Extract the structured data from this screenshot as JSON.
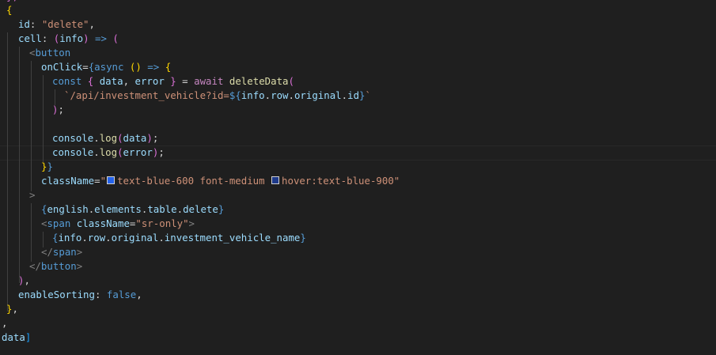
{
  "editor": {
    "lines": [
      [
        [
          "t-brace2",
          "},"
        ]
      ],
      [
        [
          "t-brace1",
          "{"
        ]
      ],
      [
        [
          "t-property",
          "id"
        ],
        [
          "t-punct",
          ": "
        ],
        [
          "t-string",
          "\"delete\""
        ],
        [
          "t-punct",
          ","
        ]
      ],
      [
        [
          "t-property",
          "cell"
        ],
        [
          "t-punct",
          ": "
        ],
        [
          "t-brace2",
          "("
        ],
        [
          "t-variable",
          "info"
        ],
        [
          "t-brace2",
          ")"
        ],
        [
          "t-keyword",
          " => "
        ],
        [
          "t-brace2",
          "("
        ]
      ],
      [
        [
          "t-tagbr",
          "<"
        ],
        [
          "t-tag",
          "button"
        ]
      ],
      [
        [
          "t-attr",
          "onClick"
        ],
        [
          "t-punct",
          "="
        ],
        [
          "t-keyword",
          "{async"
        ],
        [
          "t-punct",
          " "
        ],
        [
          "t-brace1",
          "()"
        ],
        [
          "t-keyword",
          " => "
        ],
        [
          "t-brace1",
          "{"
        ]
      ],
      [
        [
          "t-keyword",
          "const"
        ],
        [
          "t-punct",
          " "
        ],
        [
          "t-brace2",
          "{"
        ],
        [
          "t-variable",
          " data"
        ],
        [
          "t-punct",
          ", "
        ],
        [
          "t-variable",
          "error"
        ],
        [
          "t-brace2",
          " }"
        ],
        [
          "t-punct",
          " = "
        ],
        [
          "t-control",
          "await"
        ],
        [
          "t-punct",
          " "
        ],
        [
          "t-function",
          "deleteData"
        ],
        [
          "t-brace2",
          "("
        ]
      ],
      [
        [
          "t-string",
          "`/api/investment_vehicle?id="
        ],
        [
          "t-keyword",
          "${"
        ],
        [
          "t-variable",
          "info"
        ],
        [
          "t-punct",
          "."
        ],
        [
          "t-variable",
          "row"
        ],
        [
          "t-punct",
          "."
        ],
        [
          "t-variable",
          "original"
        ],
        [
          "t-punct",
          "."
        ],
        [
          "t-variable",
          "id"
        ],
        [
          "t-keyword",
          "}"
        ],
        [
          "t-string",
          "`"
        ]
      ],
      [
        [
          "t-brace2",
          ")"
        ],
        [
          "t-punct",
          ";"
        ]
      ],
      [],
      [
        [
          "t-variable",
          "console"
        ],
        [
          "t-punct",
          "."
        ],
        [
          "t-function",
          "log"
        ],
        [
          "t-brace2",
          "("
        ],
        [
          "t-variable",
          "data"
        ],
        [
          "t-brace2",
          ")"
        ],
        [
          "t-punct",
          ";"
        ]
      ],
      [
        [
          "t-variable",
          "console"
        ],
        [
          "t-punct",
          "."
        ],
        [
          "t-function",
          "log"
        ],
        [
          "t-brace2",
          "("
        ],
        [
          "t-variable",
          "error"
        ],
        [
          "t-brace2",
          ")"
        ],
        [
          "t-punct",
          ";"
        ]
      ],
      [
        [
          "t-brace1",
          "}"
        ],
        [
          "t-keyword",
          "}"
        ]
      ],
      [
        [
          "t-attr",
          "className"
        ],
        [
          "t-punct",
          "="
        ],
        [
          "t-string",
          "\""
        ],
        [
          "swatch",
          "#2563eb"
        ],
        [
          "t-string",
          "text-blue-600 font-medium "
        ],
        [
          "swatch",
          "#1e3a8a"
        ],
        [
          "t-string",
          "hover:text-blue-900\""
        ]
      ],
      [
        [
          "t-tagbr",
          ">"
        ]
      ],
      [
        [
          "t-keyword",
          "{"
        ],
        [
          "t-variable",
          "english"
        ],
        [
          "t-punct",
          "."
        ],
        [
          "t-variable",
          "elements"
        ],
        [
          "t-punct",
          "."
        ],
        [
          "t-variable",
          "table"
        ],
        [
          "t-punct",
          "."
        ],
        [
          "t-variable",
          "delete"
        ],
        [
          "t-keyword",
          "}"
        ]
      ],
      [
        [
          "t-tagbr",
          "<"
        ],
        [
          "t-tag",
          "span"
        ],
        [
          "t-attr",
          " className"
        ],
        [
          "t-punct",
          "="
        ],
        [
          "t-string",
          "\"sr-only\""
        ],
        [
          "t-tagbr",
          ">"
        ]
      ],
      [
        [
          "t-keyword",
          "{"
        ],
        [
          "t-variable",
          "info"
        ],
        [
          "t-punct",
          "."
        ],
        [
          "t-variable",
          "row"
        ],
        [
          "t-punct",
          "."
        ],
        [
          "t-variable",
          "original"
        ],
        [
          "t-punct",
          "."
        ],
        [
          "t-variable",
          "investment_vehicle_name"
        ],
        [
          "t-keyword",
          "}"
        ]
      ],
      [
        [
          "t-tagbr",
          "</"
        ],
        [
          "t-tag",
          "span"
        ],
        [
          "t-tagbr",
          ">"
        ]
      ],
      [
        [
          "t-tagbr",
          "</"
        ],
        [
          "t-tag",
          "button"
        ],
        [
          "t-tagbr",
          ">"
        ]
      ],
      [
        [
          "t-brace2",
          ")"
        ],
        [
          "t-punct",
          ","
        ]
      ],
      [
        [
          "t-property",
          "enableSorting"
        ],
        [
          "t-punct",
          ": "
        ],
        [
          "t-keyword",
          "false"
        ],
        [
          "t-punct",
          ","
        ]
      ],
      [
        [
          "t-brace1",
          "}"
        ],
        [
          "t-punct",
          ","
        ]
      ],
      [
        [
          "t-punct",
          ","
        ]
      ],
      [
        [
          "t-variable",
          "data"
        ],
        [
          "t-brace3",
          "]"
        ]
      ]
    ]
  }
}
